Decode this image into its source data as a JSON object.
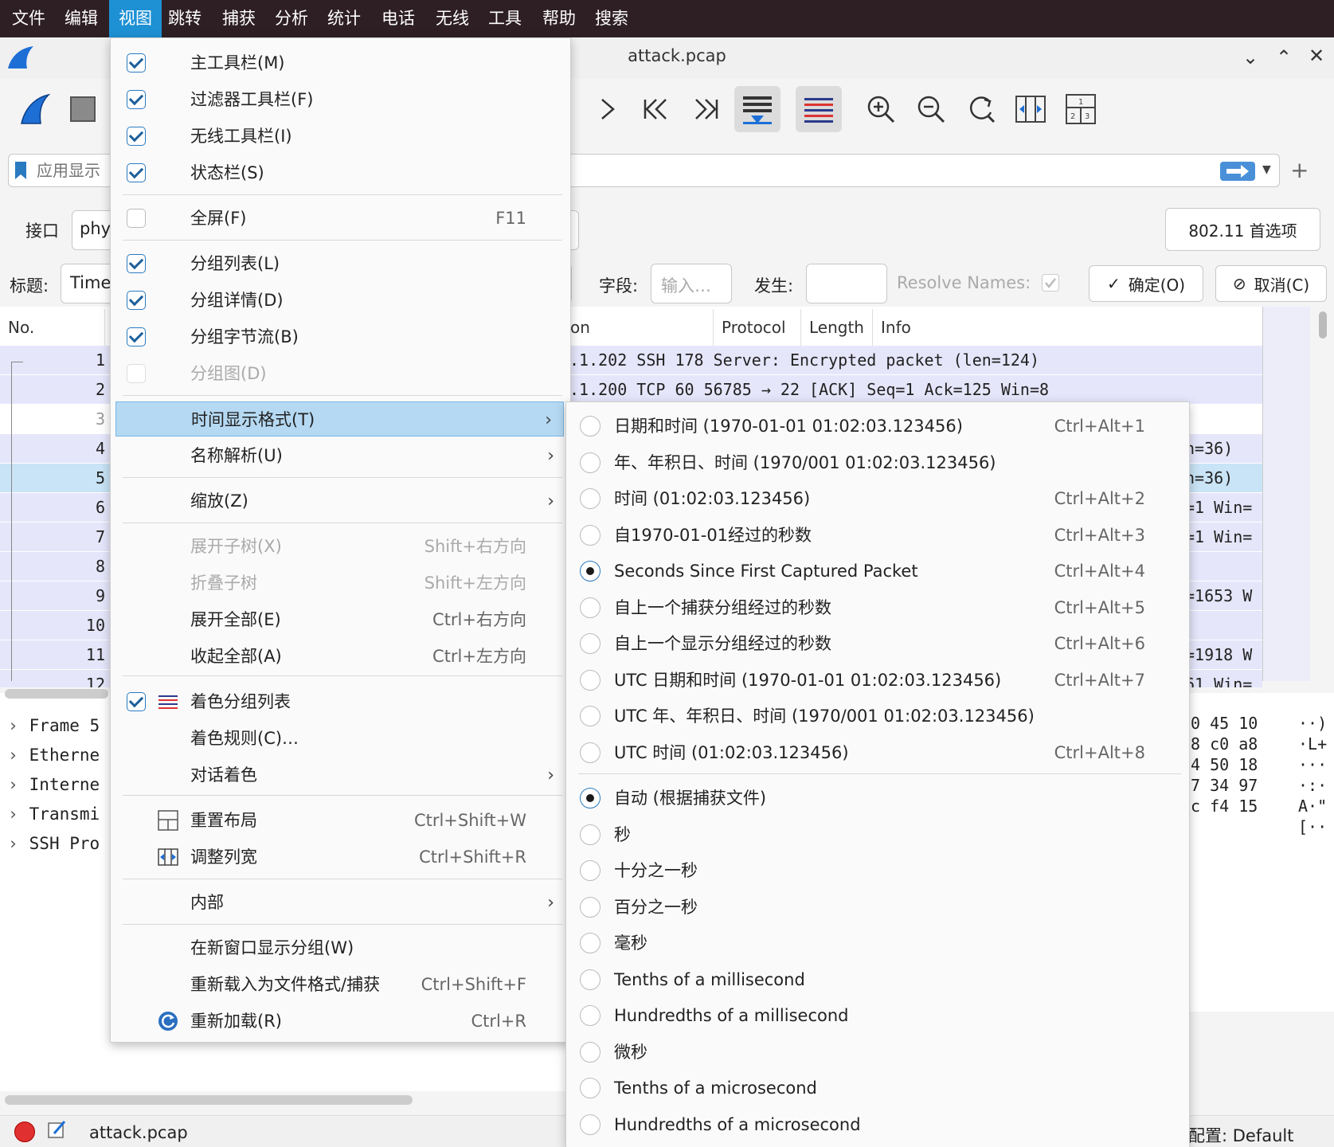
{
  "menubar": {
    "items": [
      "文件",
      "编辑",
      "视图",
      "跳转",
      "捕获",
      "分析",
      "统计",
      "电话",
      "无线",
      "工具",
      "帮助",
      "搜索"
    ],
    "active_index": 2
  },
  "window": {
    "title": "attack.pcap"
  },
  "filter": {
    "placeholder": "应用显示"
  },
  "interface_bar": {
    "label": "接口",
    "value": "phy",
    "pref_button": "802.11 首选项"
  },
  "column_edit": {
    "title_label": "标题:",
    "title_value": "Time",
    "field_label": "字段:",
    "field_placeholder": "输入…",
    "occurrence_label": "发生:",
    "resolve_label": "Resolve Names:",
    "ok_button": "确定(O)",
    "cancel_button": "取消(C)"
  },
  "packet_list": {
    "columns": {
      "no": "No.",
      "dest_tail": "on",
      "protocol": "Protocol",
      "length": "Length",
      "info": "Info"
    },
    "rows": [
      {
        "no": "1",
        "text": ".1.202       SSH        178 Server: Encrypted packet (len=124)"
      },
      {
        "no": "2",
        "text": ".1.200       TCP         60 56785 → 22 [ACK] Seq=1 Ack=125 Win=8"
      },
      {
        "no": "3",
        "text": ""
      },
      {
        "no": "4",
        "text": "n=36)"
      },
      {
        "no": "5",
        "text": "n=36)"
      },
      {
        "no": "6",
        "text": "=1 Win="
      },
      {
        "no": "7",
        "text": "=1 Win="
      },
      {
        "no": "8",
        "text": ""
      },
      {
        "no": "9",
        "text": "=1653 W"
      },
      {
        "no": "10",
        "text": ""
      },
      {
        "no": "11",
        "text": "=1918 W"
      },
      {
        "no": "12",
        "text": "61 Win="
      }
    ]
  },
  "details": {
    "rows": [
      "Frame 5",
      "Etherne",
      "Interne",
      "Transmi",
      "SSH Pro"
    ]
  },
  "hex": {
    "bytes": [
      "0 45 10",
      "8 c0 a8",
      "4 50 18",
      "7 34 97",
      "c f4 15"
    ],
    "ascii": [
      "··)",
      "·L+",
      "···",
      "·:·",
      "A·\"",
      "[··"
    ]
  },
  "statusbar": {
    "file": "attack.pcap",
    "profile": "配置: Default"
  },
  "view_menu": {
    "items": [
      {
        "label": "主工具栏(M)",
        "checked": true
      },
      {
        "label": "过滤器工具栏(F)",
        "checked": true
      },
      {
        "label": "无线工具栏(I)",
        "checked": true
      },
      {
        "label": "状态栏(S)",
        "checked": true
      },
      {
        "label": "全屏(F)",
        "checked": false,
        "shortcut": "F11"
      },
      {
        "label": "分组列表(L)",
        "checked": true
      },
      {
        "label": "分组详情(D)",
        "checked": true
      },
      {
        "label": "分组字节流(B)",
        "checked": true
      },
      {
        "label": "分组图(D)",
        "checked": false,
        "disabled": true
      },
      {
        "label": "时间显示格式(T)",
        "submenu": true,
        "highlight": true
      },
      {
        "label": "名称解析(U)",
        "submenu": true
      },
      {
        "label": "缩放(Z)",
        "submenu": true
      },
      {
        "label": "展开子树(X)",
        "shortcut": "Shift+右方向",
        "disabled": true
      },
      {
        "label": "折叠子树",
        "shortcut": "Shift+左方向",
        "disabled": true
      },
      {
        "label": "展开全部(E)",
        "shortcut": "Ctrl+右方向"
      },
      {
        "label": "收起全部(A)",
        "shortcut": "Ctrl+左方向"
      },
      {
        "label": "着色分组列表",
        "checked": true,
        "icon": "colorize-icon"
      },
      {
        "label": "着色规则(C)…"
      },
      {
        "label": "对话着色",
        "submenu": true
      },
      {
        "label": "重置布局",
        "shortcut": "Ctrl+Shift+W",
        "icon": "reset-layout-icon"
      },
      {
        "label": "调整列宽",
        "shortcut": "Ctrl+Shift+R",
        "icon": "resize-columns-icon"
      },
      {
        "label": "内部",
        "submenu": true
      },
      {
        "label": "在新窗口显示分组(W)"
      },
      {
        "label": "重新载入为文件格式/捕获",
        "shortcut": "Ctrl+Shift+F"
      },
      {
        "label": "重新加载(R)",
        "shortcut": "Ctrl+R",
        "icon": "reload-icon"
      }
    ]
  },
  "time_menu": {
    "formats": [
      {
        "label": "日期和时间 (1970-01-01 01:02:03.123456)",
        "shortcut": "Ctrl+Alt+1"
      },
      {
        "label": "年、年积日、时间 (1970/001 01:02:03.123456)",
        "shortcut": ""
      },
      {
        "label": "时间 (01:02:03.123456)",
        "shortcut": "Ctrl+Alt+2"
      },
      {
        "label": "自1970-01-01经过的秒数",
        "shortcut": "Ctrl+Alt+3"
      },
      {
        "label": "Seconds Since First Captured Packet",
        "shortcut": "Ctrl+Alt+4",
        "selected": true
      },
      {
        "label": "自上一个捕获分组经过的秒数",
        "shortcut": "Ctrl+Alt+5"
      },
      {
        "label": "自上一个显示分组经过的秒数",
        "shortcut": "Ctrl+Alt+6"
      },
      {
        "label": "UTC 日期和时间 (1970-01-01 01:02:03.123456)",
        "shortcut": "Ctrl+Alt+7"
      },
      {
        "label": "UTC 年、年积日、时间 (1970/001 01:02:03.123456)",
        "shortcut": ""
      },
      {
        "label": "UTC 时间 (01:02:03.123456)",
        "shortcut": "Ctrl+Alt+8"
      }
    ],
    "precisions": [
      {
        "label": "自动 (根据捕获文件)",
        "selected": true
      },
      {
        "label": "秒"
      },
      {
        "label": "十分之一秒"
      },
      {
        "label": "百分之一秒"
      },
      {
        "label": "毫秒"
      },
      {
        "label": "Tenths of a millisecond"
      },
      {
        "label": "Hundredths of a millisecond"
      },
      {
        "label": "微秒"
      },
      {
        "label": "Tenths of a microsecond"
      },
      {
        "label": "Hundredths of a microsecond"
      }
    ]
  },
  "colors": {
    "menubar_bg": "#2e1f24",
    "menubar_active": "#1e90d4",
    "row_highlight": "#e6e6fb",
    "row_selected": "#c9e4f6",
    "menu_highlight": "#b5d9f3"
  }
}
